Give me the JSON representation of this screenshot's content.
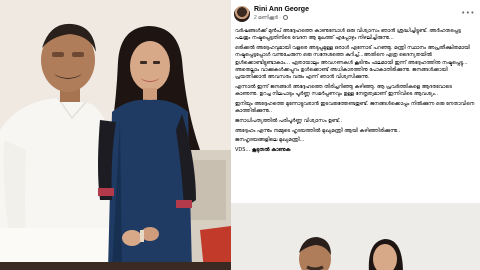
{
  "post": {
    "author": "Rini Ann George",
    "time": "2 മണിക്കൂർ",
    "paragraphs": [
      "വർഷങ്ങൾക്ക് മുൻപ് അദ്ദേഹത്തെ കാണുമ്പോൾ ഒരു വിശ്വാസം ഞാൻ ശ്രദ്ധിച്ചിട്ടുണ്ട്. അർഹതപ്പെട്ട പലതും നഷ്ടപ്പെട്ടതിനിടെ വേദന ആ മുഖത്ത് എപ്പോഴും നിഴലിച്ചിരുന്നു...",
      "ഒരിക്കൽ അദ്ദേഹവുമായി വളരെ അടുപ്പമുള്ള ഒരാൾ എന്നോട് പറഞ്ഞു. മന്ത്രി സ്ഥാനം അപ്രതീക്ഷിതമായി നഷ്ടപ്പെട്ടപ്പോൾ വന്നുചേരുന്ന ഒരു സന്ദേശത്തെ കുറിച്ച്...അതിനെ എത്ര ദൈന്യതയിൽ ഉൾക്കൊണ്ടിട്ടുണ്ടാകാം... ഏതായാലും അവഗണകൾ കൂടിനും ഫലമായി ഇന്ന് അദ്ദേഹത്തിനു നഷ്ടപ്പെട്ടു... അതെല്ലാം വാക്കുകൾക്കപ്പുറം ഉൾക്കൊണ്ട് അധികാരത്തിനു പോകാതിരിക്കുന്നു. ജനങ്ങൾക്കായി പ്രയത്നിക്കാൻ അവസരം വരും എന്ന് ഞാൻ വിശ്വസിക്കുന്നു.",
      "എന്നാൽ ഇന്ന് ജനങ്ങൾ അദ്ദേഹത്തെ തിരിച്ചറിഞ്ഞു കഴിഞ്ഞു. ആ പ്രവർത്തികളെ ആദരവോടെ കാണുന്നു. ഉറച്ച നിലപാടും പൂർണ്ണ സമർപ്പണവും ഉള്ള നേതൃത്വമാണ് ഇന്നിവിടെ ആവശ്യം..",
      "ഇനിയും അദ്ദേഹത്തെ മുന്നോട്ടുവരാൻ ഇടവരുത്തേണ്ടതുണ്ട്. ജനങ്ങൾക്കൊപ്പം നിൽക്കുന്ന ഒരു നേതാവിനെ കാത്തിരിക്കുന്നു..",
      "ജനാധിപത്യത്തിൽ പരിപൂർണ്ണ വിശ്വാസം ഉണ്ട്..",
      "അദ്ദേഹം എന്നും നമ്മുടെ ഹൃദയത്തിൽ മുഖ്യമന്ത്രി ആയി കഴിഞ്ഞിരിക്കുന്നു..",
      "ജനഹൃദയങ്ങളിലെ മുഖ്യമന്ത്രി..."
    ],
    "signature": "VDS... ",
    "see_more": "കൂടുതൽ കാണുക",
    "icons": {
      "avatar": "profile-avatar",
      "globe": "globe-icon",
      "more": "more-icon"
    }
  }
}
